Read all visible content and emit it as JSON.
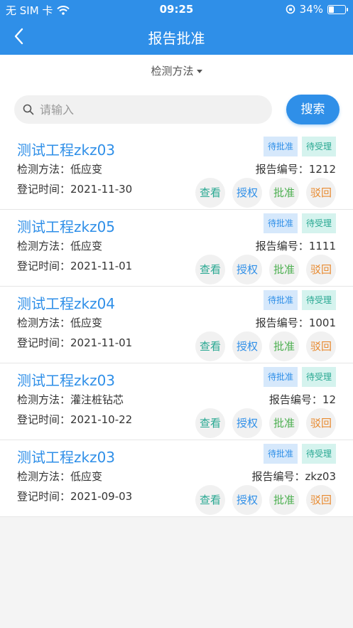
{
  "status_bar": {
    "carrier": "无 SIM 卡",
    "time": "09:25",
    "battery": "34%",
    "battery_level": 0.34
  },
  "header": {
    "title": "报告批准"
  },
  "filter": {
    "label": "检测方法"
  },
  "search": {
    "placeholder": "请输入",
    "button": "搜索"
  },
  "labels": {
    "method": "检测方法：",
    "date": "登记时间：",
    "report_no": "报告编号："
  },
  "tags": {
    "pending_approval": "待批准",
    "pending_accept": "待受理"
  },
  "actions": {
    "view": "查看",
    "authorize": "授权",
    "approve": "批准",
    "reject": "驳回"
  },
  "records": [
    {
      "title": "测试工程zkz03",
      "method": "低应变",
      "report_no": "1212",
      "date": "2021-11-30"
    },
    {
      "title": "测试工程zkz05",
      "method": "低应变",
      "report_no": "1111",
      "date": "2021-11-01"
    },
    {
      "title": "测试工程zkz04",
      "method": "低应变",
      "report_no": "1001",
      "date": "2021-11-01"
    },
    {
      "title": "测试工程zkz03",
      "method": "灌注桩钻芯",
      "report_no": "12",
      "date": "2021-10-22"
    },
    {
      "title": "测试工程zkz03",
      "method": "低应变",
      "report_no": "zkz03",
      "date": "2021-09-03"
    }
  ]
}
